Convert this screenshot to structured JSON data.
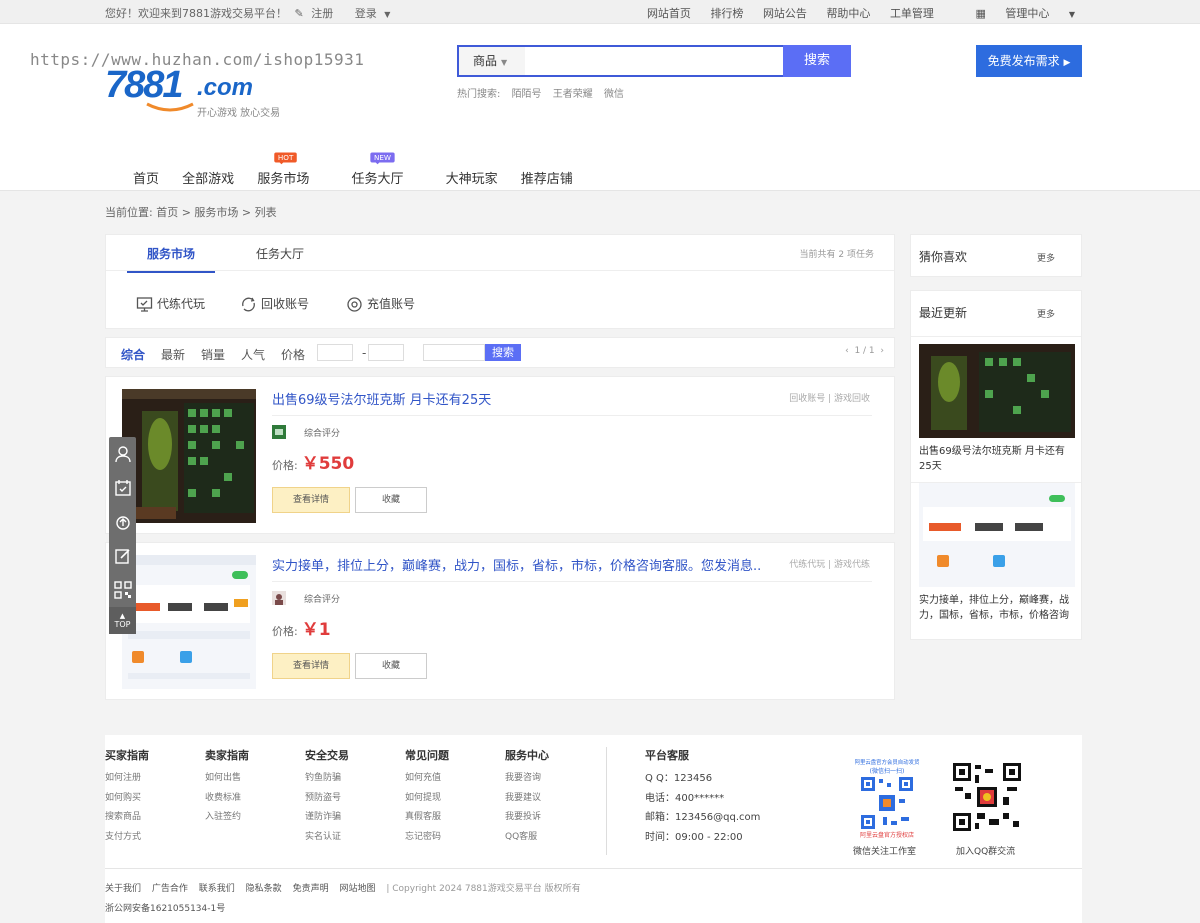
{
  "topbar": {
    "welcome": "您好！欢迎来到7881游戏交易平台！",
    "register": "注册",
    "login": "登录",
    "links": [
      "网站首页",
      "排行榜",
      "网站公告",
      "帮助中心",
      "工单管理"
    ],
    "admin": "管理中心"
  },
  "header": {
    "watermark": "https://www.huzhan.com/ishop15931",
    "logo_num": "7881",
    "logo_com": ".com",
    "slogan": "开心游戏 放心交易",
    "search_category": "商品",
    "search_button": "搜索",
    "search_value": "",
    "hot_label": "热门搜索:",
    "hot_terms": [
      "陌陌号",
      "王者荣耀",
      "微信"
    ],
    "publish_button": "免费发布需求"
  },
  "nav": {
    "items": [
      "首页",
      "全部游戏",
      "服务市场",
      "任务大厅",
      "大神玩家",
      "推荐店铺"
    ],
    "hot_tag": "HOT",
    "new_tag": "NEW"
  },
  "breadcrumb": "当前位置: 首页 > 服务市场 > 列表",
  "tabs": {
    "items": [
      "服务市场",
      "任务大厅"
    ],
    "total": "当前共有 2 项任务",
    "categories": [
      "代练代玩",
      "回收账号",
      "充值账号"
    ]
  },
  "filter": {
    "sorts": [
      "综合",
      "最新",
      "销量",
      "人气",
      "价格"
    ],
    "range_sep": "-",
    "search": "搜索",
    "pager": "1 / 1"
  },
  "items": [
    {
      "title": "出售69级号法尔班克斯 月卡还有25天",
      "cats": "回收账号 | 游戏回收",
      "score_label": "综合评分",
      "price_label": "价格:",
      "price": "￥550",
      "detail_button": "查看详情",
      "fav_button": "收藏"
    },
    {
      "title": "实力接单，排位上分，巅峰赛，战力，国标，省标，市标，价格咨询客服。您发消息...",
      "cats": "代练代玩 | 游戏代练",
      "score_label": "综合评分",
      "price_label": "价格:",
      "price": "￥1",
      "detail_button": "查看详情",
      "fav_button": "收藏"
    }
  ],
  "sidebar": {
    "guess": "猜你喜欢",
    "recent": "最近更新",
    "more": "更多",
    "recent_items": [
      "出售69级号法尔班克斯 月卡还有25天",
      "实力接单，排位上分，巅峰赛，战力，国标，省标，市标，价格咨询"
    ]
  },
  "float_top": "TOP",
  "footer": {
    "cols": [
      {
        "title": "买家指南",
        "links": [
          "如何注册",
          "如何购买",
          "搜索商品",
          "支付方式"
        ]
      },
      {
        "title": "卖家指南",
        "links": [
          "如何出售",
          "收费标准",
          "入驻签约"
        ]
      },
      {
        "title": "安全交易",
        "links": [
          "钓鱼防骗",
          "预防盗号",
          "谨防诈骗",
          "实名认证"
        ]
      },
      {
        "title": "常见问题",
        "links": [
          "如何充值",
          "如何提现",
          "真假客服",
          "忘记密码"
        ]
      },
      {
        "title": "服务中心",
        "links": [
          "我要咨询",
          "我要建议",
          "我要投诉",
          "QQ客服"
        ]
      }
    ],
    "service_title": "平台客服",
    "service": [
      "Q Q：123456",
      "电话：400******",
      "邮箱：123456@qq.com",
      "时间：09:00 - 22:00"
    ],
    "qr1_top": "阿里云盘官方会员自动发货",
    "qr1_sub": "(微信扫一扫)",
    "qr1_bottom": "阿里云盘官方授权店",
    "qr1_caption": "微信关注工作室",
    "qr2_caption": "加入QQ群交流",
    "links": [
      "关于我们",
      "广告合作",
      "联系我们",
      "隐私条款",
      "免责声明",
      "网站地图"
    ],
    "copyright": "| Copyright 2024 7881游戏交易平台 版权所有",
    "icp": "浙公网安备1621055134-1号"
  },
  "colors": {
    "accent": "#3155c7",
    "search_btn": "#5b6ef5",
    "publish": "#2d6cdf",
    "price": "#e03c3c"
  }
}
